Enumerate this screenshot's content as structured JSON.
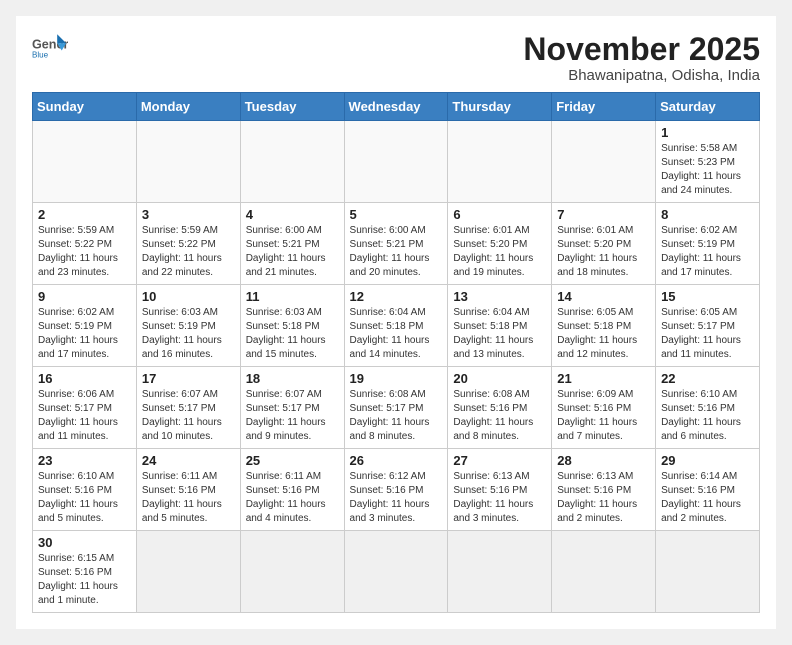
{
  "logo": {
    "text_general": "General",
    "text_blue": "Blue"
  },
  "title": "November 2025",
  "location": "Bhawanipatna, Odisha, India",
  "weekdays": [
    "Sunday",
    "Monday",
    "Tuesday",
    "Wednesday",
    "Thursday",
    "Friday",
    "Saturday"
  ],
  "weeks": [
    [
      {
        "day": "",
        "info": ""
      },
      {
        "day": "",
        "info": ""
      },
      {
        "day": "",
        "info": ""
      },
      {
        "day": "",
        "info": ""
      },
      {
        "day": "",
        "info": ""
      },
      {
        "day": "",
        "info": ""
      },
      {
        "day": "1",
        "info": "Sunrise: 5:58 AM\nSunset: 5:23 PM\nDaylight: 11 hours\nand 24 minutes."
      }
    ],
    [
      {
        "day": "2",
        "info": "Sunrise: 5:59 AM\nSunset: 5:22 PM\nDaylight: 11 hours\nand 23 minutes."
      },
      {
        "day": "3",
        "info": "Sunrise: 5:59 AM\nSunset: 5:22 PM\nDaylight: 11 hours\nand 22 minutes."
      },
      {
        "day": "4",
        "info": "Sunrise: 6:00 AM\nSunset: 5:21 PM\nDaylight: 11 hours\nand 21 minutes."
      },
      {
        "day": "5",
        "info": "Sunrise: 6:00 AM\nSunset: 5:21 PM\nDaylight: 11 hours\nand 20 minutes."
      },
      {
        "day": "6",
        "info": "Sunrise: 6:01 AM\nSunset: 5:20 PM\nDaylight: 11 hours\nand 19 minutes."
      },
      {
        "day": "7",
        "info": "Sunrise: 6:01 AM\nSunset: 5:20 PM\nDaylight: 11 hours\nand 18 minutes."
      },
      {
        "day": "8",
        "info": "Sunrise: 6:02 AM\nSunset: 5:19 PM\nDaylight: 11 hours\nand 17 minutes."
      }
    ],
    [
      {
        "day": "9",
        "info": "Sunrise: 6:02 AM\nSunset: 5:19 PM\nDaylight: 11 hours\nand 17 minutes."
      },
      {
        "day": "10",
        "info": "Sunrise: 6:03 AM\nSunset: 5:19 PM\nDaylight: 11 hours\nand 16 minutes."
      },
      {
        "day": "11",
        "info": "Sunrise: 6:03 AM\nSunset: 5:18 PM\nDaylight: 11 hours\nand 15 minutes."
      },
      {
        "day": "12",
        "info": "Sunrise: 6:04 AM\nSunset: 5:18 PM\nDaylight: 11 hours\nand 14 minutes."
      },
      {
        "day": "13",
        "info": "Sunrise: 6:04 AM\nSunset: 5:18 PM\nDaylight: 11 hours\nand 13 minutes."
      },
      {
        "day": "14",
        "info": "Sunrise: 6:05 AM\nSunset: 5:18 PM\nDaylight: 11 hours\nand 12 minutes."
      },
      {
        "day": "15",
        "info": "Sunrise: 6:05 AM\nSunset: 5:17 PM\nDaylight: 11 hours\nand 11 minutes."
      }
    ],
    [
      {
        "day": "16",
        "info": "Sunrise: 6:06 AM\nSunset: 5:17 PM\nDaylight: 11 hours\nand 11 minutes."
      },
      {
        "day": "17",
        "info": "Sunrise: 6:07 AM\nSunset: 5:17 PM\nDaylight: 11 hours\nand 10 minutes."
      },
      {
        "day": "18",
        "info": "Sunrise: 6:07 AM\nSunset: 5:17 PM\nDaylight: 11 hours\nand 9 minutes."
      },
      {
        "day": "19",
        "info": "Sunrise: 6:08 AM\nSunset: 5:17 PM\nDaylight: 11 hours\nand 8 minutes."
      },
      {
        "day": "20",
        "info": "Sunrise: 6:08 AM\nSunset: 5:16 PM\nDaylight: 11 hours\nand 8 minutes."
      },
      {
        "day": "21",
        "info": "Sunrise: 6:09 AM\nSunset: 5:16 PM\nDaylight: 11 hours\nand 7 minutes."
      },
      {
        "day": "22",
        "info": "Sunrise: 6:10 AM\nSunset: 5:16 PM\nDaylight: 11 hours\nand 6 minutes."
      }
    ],
    [
      {
        "day": "23",
        "info": "Sunrise: 6:10 AM\nSunset: 5:16 PM\nDaylight: 11 hours\nand 5 minutes."
      },
      {
        "day": "24",
        "info": "Sunrise: 6:11 AM\nSunset: 5:16 PM\nDaylight: 11 hours\nand 5 minutes."
      },
      {
        "day": "25",
        "info": "Sunrise: 6:11 AM\nSunset: 5:16 PM\nDaylight: 11 hours\nand 4 minutes."
      },
      {
        "day": "26",
        "info": "Sunrise: 6:12 AM\nSunset: 5:16 PM\nDaylight: 11 hours\nand 3 minutes."
      },
      {
        "day": "27",
        "info": "Sunrise: 6:13 AM\nSunset: 5:16 PM\nDaylight: 11 hours\nand 3 minutes."
      },
      {
        "day": "28",
        "info": "Sunrise: 6:13 AM\nSunset: 5:16 PM\nDaylight: 11 hours\nand 2 minutes."
      },
      {
        "day": "29",
        "info": "Sunrise: 6:14 AM\nSunset: 5:16 PM\nDaylight: 11 hours\nand 2 minutes."
      }
    ],
    [
      {
        "day": "30",
        "info": "Sunrise: 6:15 AM\nSunset: 5:16 PM\nDaylight: 11 hours\nand 1 minute."
      },
      {
        "day": "",
        "info": ""
      },
      {
        "day": "",
        "info": ""
      },
      {
        "day": "",
        "info": ""
      },
      {
        "day": "",
        "info": ""
      },
      {
        "day": "",
        "info": ""
      },
      {
        "day": "",
        "info": ""
      }
    ]
  ]
}
